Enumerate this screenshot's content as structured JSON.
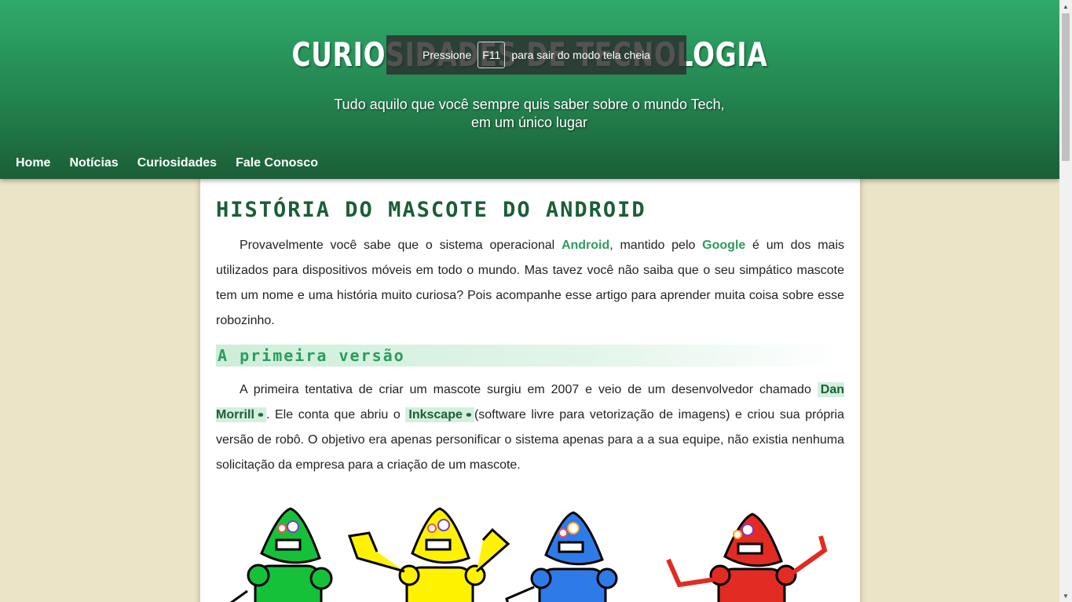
{
  "header": {
    "title": "CURIOSIDADES DE TECNOLOGIA",
    "subtitle": "Tudo aquilo que você sempre quis saber sobre o mundo Tech, em um único lugar"
  },
  "nav": {
    "items": [
      "Home",
      "Notícias",
      "Curiosidades",
      "Fale Conosco"
    ]
  },
  "fullscreen_notice": {
    "prefix": "Pressione",
    "key": "F11",
    "suffix": "para sair do modo tela cheia"
  },
  "article": {
    "title": "História do mascote do Android",
    "p1": {
      "t1": "Provavelmente você sabe que o sistema operacional ",
      "k1": "Android",
      "t2": ", mantido pelo ",
      "k2": "Google",
      "t3": " é um dos mais utilizados para dispositivos móveis em todo o mundo. Mas tavez você não saiba que o seu simpático mascote tem um nome e uma história muito curiosa? Pois acompanhe esse artigo para aprender muita coisa sobre esse robozinho."
    },
    "section1_title": "A primeira versão",
    "p2": {
      "t1": "A primeira tentativa de criar um mascote surgiu em 2007 e veio de um desenvolvedor chamado ",
      "link1": "Dan Morrill",
      "t2": ". Ele conta que abriu o ",
      "link2": "Inkscape",
      "t3": "(software livre para vetorização de imagens) e criou sua própria versão de robô. O objetivo era apenas personificar o sistema apenas para a a sua equipe, não existia nenhuma solicitação da empresa para a criação de um mascote."
    }
  },
  "colors": {
    "header_top": "#2faa69",
    "header_bottom": "#1b5e37",
    "accent": "#2a9d5c",
    "background": "#ece4c7"
  },
  "icons": [
    "link-chain-icon",
    "scroll-up-icon",
    "scroll-down-icon"
  ]
}
